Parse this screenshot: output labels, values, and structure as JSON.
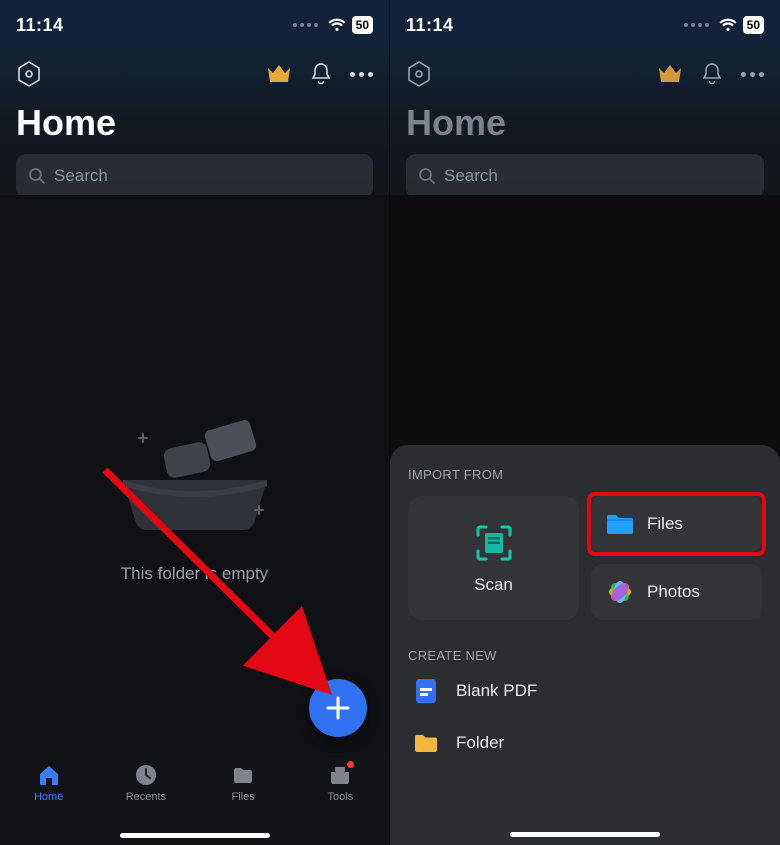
{
  "status": {
    "time": "11:14",
    "battery": "50"
  },
  "header": {
    "title": "Home",
    "search_placeholder": "Search"
  },
  "empty_state": {
    "message": "This folder is empty"
  },
  "tabs": {
    "home": "Home",
    "recents": "Recents",
    "files": "Files",
    "tools": "Tools"
  },
  "sheet": {
    "import_heading": "IMPORT FROM",
    "create_heading": "CREATE NEW",
    "scan": "Scan",
    "files": "Files",
    "photos": "Photos",
    "blank_pdf": "Blank PDF",
    "folder": "Folder"
  }
}
